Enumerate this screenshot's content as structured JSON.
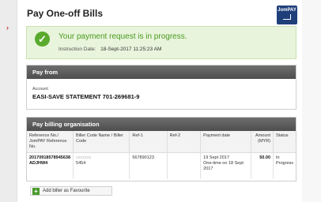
{
  "page": {
    "title": "Pay One-off Bills",
    "logo_text": "JomPAY"
  },
  "status": {
    "message": "Your payment request is in progress.",
    "instruction_label": "Instruction Date:",
    "instruction_value": "18-Sept-2017 11:25:23 AM",
    "color": "#4a9a1e"
  },
  "pay_from": {
    "heading": "Pay from",
    "account_label": "Account",
    "account_value": "EASI-SAVE STATEMENT 701-269681-9"
  },
  "billing": {
    "heading": "Pay billing organisation",
    "columns": {
      "ref_no": "Reference No./ JomPAY Reference No.",
      "biller": "Biller Code Name / Biller Code",
      "ref1": "Ref-1",
      "ref2": "Ref-2",
      "payment_date": "Payment date",
      "amount": "Amount (MYR)",
      "status": "Status"
    },
    "row": {
      "ref_no_line1": "20170918578945638",
      "ref_no_line2": "ADJHW4",
      "biller_name": "xxxxxxx",
      "biller_code": "5454",
      "ref1": "567890123",
      "ref2": "",
      "payment_date_line1": "19 Sept 2017",
      "payment_date_line2": "One-time on 18 Sept 2017",
      "amount": "50.00",
      "status": "In Progress"
    }
  },
  "actions": {
    "add_favourite_label": "Add biller as Favourite"
  }
}
